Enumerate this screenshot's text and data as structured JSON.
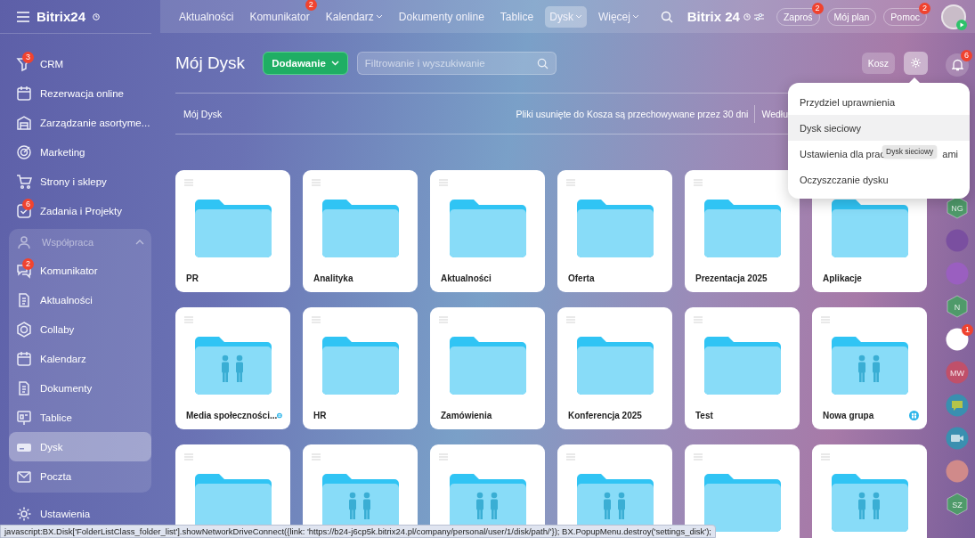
{
  "sidebar": {
    "logo": "Bitrix24",
    "items": [
      {
        "label": "CRM",
        "badge": "3",
        "selected": false
      },
      {
        "label": "Rezerwacja online",
        "selected": false
      },
      {
        "label": "Zarządzanie asortyme...",
        "selected": false
      },
      {
        "label": "Marketing",
        "selected": false
      },
      {
        "label": "Strony i sklepy",
        "selected": false
      },
      {
        "label": "Zadania i Projekty",
        "badge": "6",
        "selected": false
      }
    ],
    "group": {
      "label": "Współpraca",
      "expanded": true,
      "children": [
        {
          "label": "Komunikator",
          "badge": "2",
          "selected": false
        },
        {
          "label": "Aktualności",
          "selected": false
        },
        {
          "label": "Collaby",
          "selected": false
        },
        {
          "label": "Kalendarz",
          "selected": false
        },
        {
          "label": "Dokumenty",
          "selected": false
        },
        {
          "label": "Tablice",
          "selected": false
        },
        {
          "label": "Dysk",
          "selected": true
        },
        {
          "label": "Poczta",
          "selected": false
        }
      ]
    },
    "footer": "Ustawienia"
  },
  "top_nav": [
    {
      "label": "Aktualności",
      "dropdown": false,
      "selected": false
    },
    {
      "label": "Komunikator",
      "badge": "2",
      "dropdown": false,
      "selected": false
    },
    {
      "label": "Kalendarz",
      "dropdown": true,
      "selected": false
    },
    {
      "label": "Dokumenty online",
      "dropdown": false,
      "selected": false
    },
    {
      "label": "Tablice",
      "dropdown": false,
      "selected": false
    },
    {
      "label": "Dysk",
      "dropdown": true,
      "selected": true
    },
    {
      "label": "Więcej",
      "dropdown": true,
      "selected": false
    }
  ],
  "brand": "Bitrix 24",
  "top_buttons": [
    {
      "label": "Zaproś",
      "badge": "2"
    },
    {
      "label": "Mój plan"
    },
    {
      "label": "Pomoc",
      "badge": "2"
    }
  ],
  "page": {
    "title": "Mój Dysk",
    "add_button": "Dodawanie",
    "search": {
      "placeholder": "Filtrowanie i wyszukiwanie"
    },
    "trash_button": "Kosz",
    "settings_open": true,
    "notifications_badge": "6",
    "breadcrumb": "Mój Dysk",
    "retention_note": "Pliki usunięte do Kosza są przechowywane przez 30 dni",
    "sort_label": "Wedłu"
  },
  "folders": [
    {
      "name": "PR",
      "shared": false
    },
    {
      "name": "Analityka",
      "shared": false
    },
    {
      "name": "Aktualności",
      "shared": false
    },
    {
      "name": "Oferta",
      "shared": false
    },
    {
      "name": "Prezentacja 2025",
      "shared": false
    },
    {
      "name": "Aplikacje",
      "shared": false
    },
    {
      "name": "Media społeczności...",
      "shared": true
    },
    {
      "name": "HR",
      "shared": false
    },
    {
      "name": "Zamówienia",
      "shared": false
    },
    {
      "name": "Konferencja 2025",
      "shared": false
    },
    {
      "name": "Test",
      "shared": false
    },
    {
      "name": "Nowa grupa",
      "shared": true
    },
    {
      "shared": false
    },
    {
      "shared": true
    },
    {
      "shared": true
    },
    {
      "shared": true
    },
    {
      "shared": false
    },
    {
      "shared": true
    }
  ],
  "settings_menu": {
    "items": [
      {
        "label": "Przydziel uprawnienia",
        "selected": false
      },
      {
        "label": "Dysk sieciowy",
        "selected": true
      },
      {
        "label": "Ustawienia dla prac",
        "label_end": "ami",
        "selected": false
      },
      {
        "label": "Oczyszczanie dysku",
        "selected": false
      }
    ],
    "tooltip": "Dysk sieciowy"
  },
  "right_strip": [
    {
      "kind": "hexagon",
      "initials": "NG",
      "color": "#4f9a6a"
    },
    {
      "kind": "avatar",
      "color": "#7a4fa0"
    },
    {
      "kind": "avatar",
      "color": "#9a5fc0"
    },
    {
      "kind": "hexagon",
      "initials": "N",
      "color": "#4f9a6a"
    },
    {
      "kind": "avatar",
      "badge": "1",
      "color": "#ffffff"
    },
    {
      "kind": "circle",
      "initials": "MW",
      "color": "#c0506a"
    },
    {
      "kind": "chat",
      "color": "#3a8fb0"
    },
    {
      "kind": "video",
      "color": "#3a8fb0"
    },
    {
      "kind": "avatar",
      "color": "#d08a8a"
    },
    {
      "kind": "hexagon",
      "initials": "SZ",
      "color": "#4f9a6a"
    }
  ],
  "status_bar": "javascript:BX.Disk['FolderListClass_folder_list'].showNetworkDriveConnect({link: 'https://b24-j6cp5k.bitrix24.pl/company/personal/user/1/disk/path/'}); BX.PopupMenu.destroy('settings_disk');"
}
